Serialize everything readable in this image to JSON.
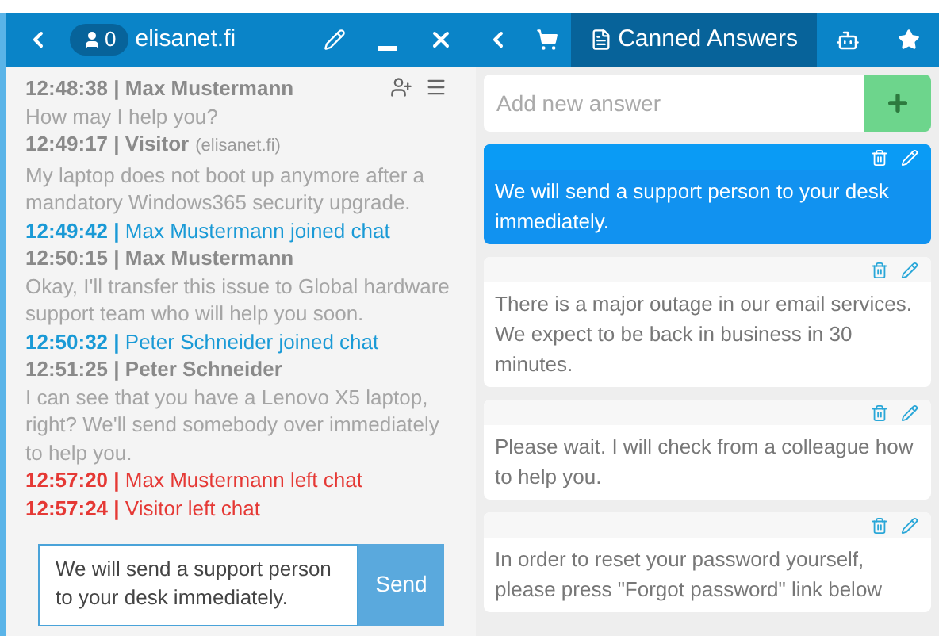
{
  "header": {
    "visitor_count": "0",
    "site": "elisanet.fi"
  },
  "tabs": [
    {
      "kind": "canned",
      "label": "Canned Answers",
      "selected": true
    },
    {
      "kind": "bot",
      "selected": false
    },
    {
      "kind": "favorites",
      "selected": false
    }
  ],
  "chat": {
    "messages": [
      {
        "kind": "message",
        "header": "12:48:38 | Max Mustermann",
        "text": "How may I help you?"
      },
      {
        "kind": "message",
        "header": "12:49:17 | Visitor",
        "source": "(elisanet.fi)",
        "text": "My laptop does not boot up anymore after a mandatory Windows365 security upgrade."
      },
      {
        "kind": "event",
        "text": "**12:49:42 |** Max Mustermann joined chat",
        "color": "#1a9ad6"
      },
      {
        "kind": "message",
        "header": "12:50:15 | Max Mustermann",
        "text": "Okay, I'll transfer this issue to Global hardware support team who will help you soon."
      },
      {
        "kind": "event",
        "text": "**12:50:32 |** Peter Schneider joined chat",
        "color": "#1a9ad6"
      },
      {
        "kind": "message",
        "header": "12:51:25 | Peter Schneider",
        "text": "I can see that you have a Lenovo X5 laptop, right? We'll send somebody over immediately to help you."
      },
      {
        "kind": "event",
        "text": "**12:57:20 |** Max Mustermann left chat",
        "color": "#e53935"
      },
      {
        "kind": "event",
        "text": "**12:57:24 |** Visitor left chat",
        "color": "#e53935"
      }
    ],
    "reply": {
      "value": "We will send a support person to your desk immediately.",
      "send": "Send"
    }
  },
  "canned": {
    "placeholder": "Add new answer",
    "answers": [
      {
        "text": "We will send a support person to your desk immediately.",
        "selected": true
      },
      {
        "text": "There is a major outage in our email services. We expect to be back in business in 30 minutes.",
        "selected": false
      },
      {
        "text": "Please wait. I will check from a colleague how to help you.",
        "selected": false
      },
      {
        "text": "In order to reset your password yourself, please press \"Forgot password\" link below",
        "selected": false
      }
    ]
  }
}
